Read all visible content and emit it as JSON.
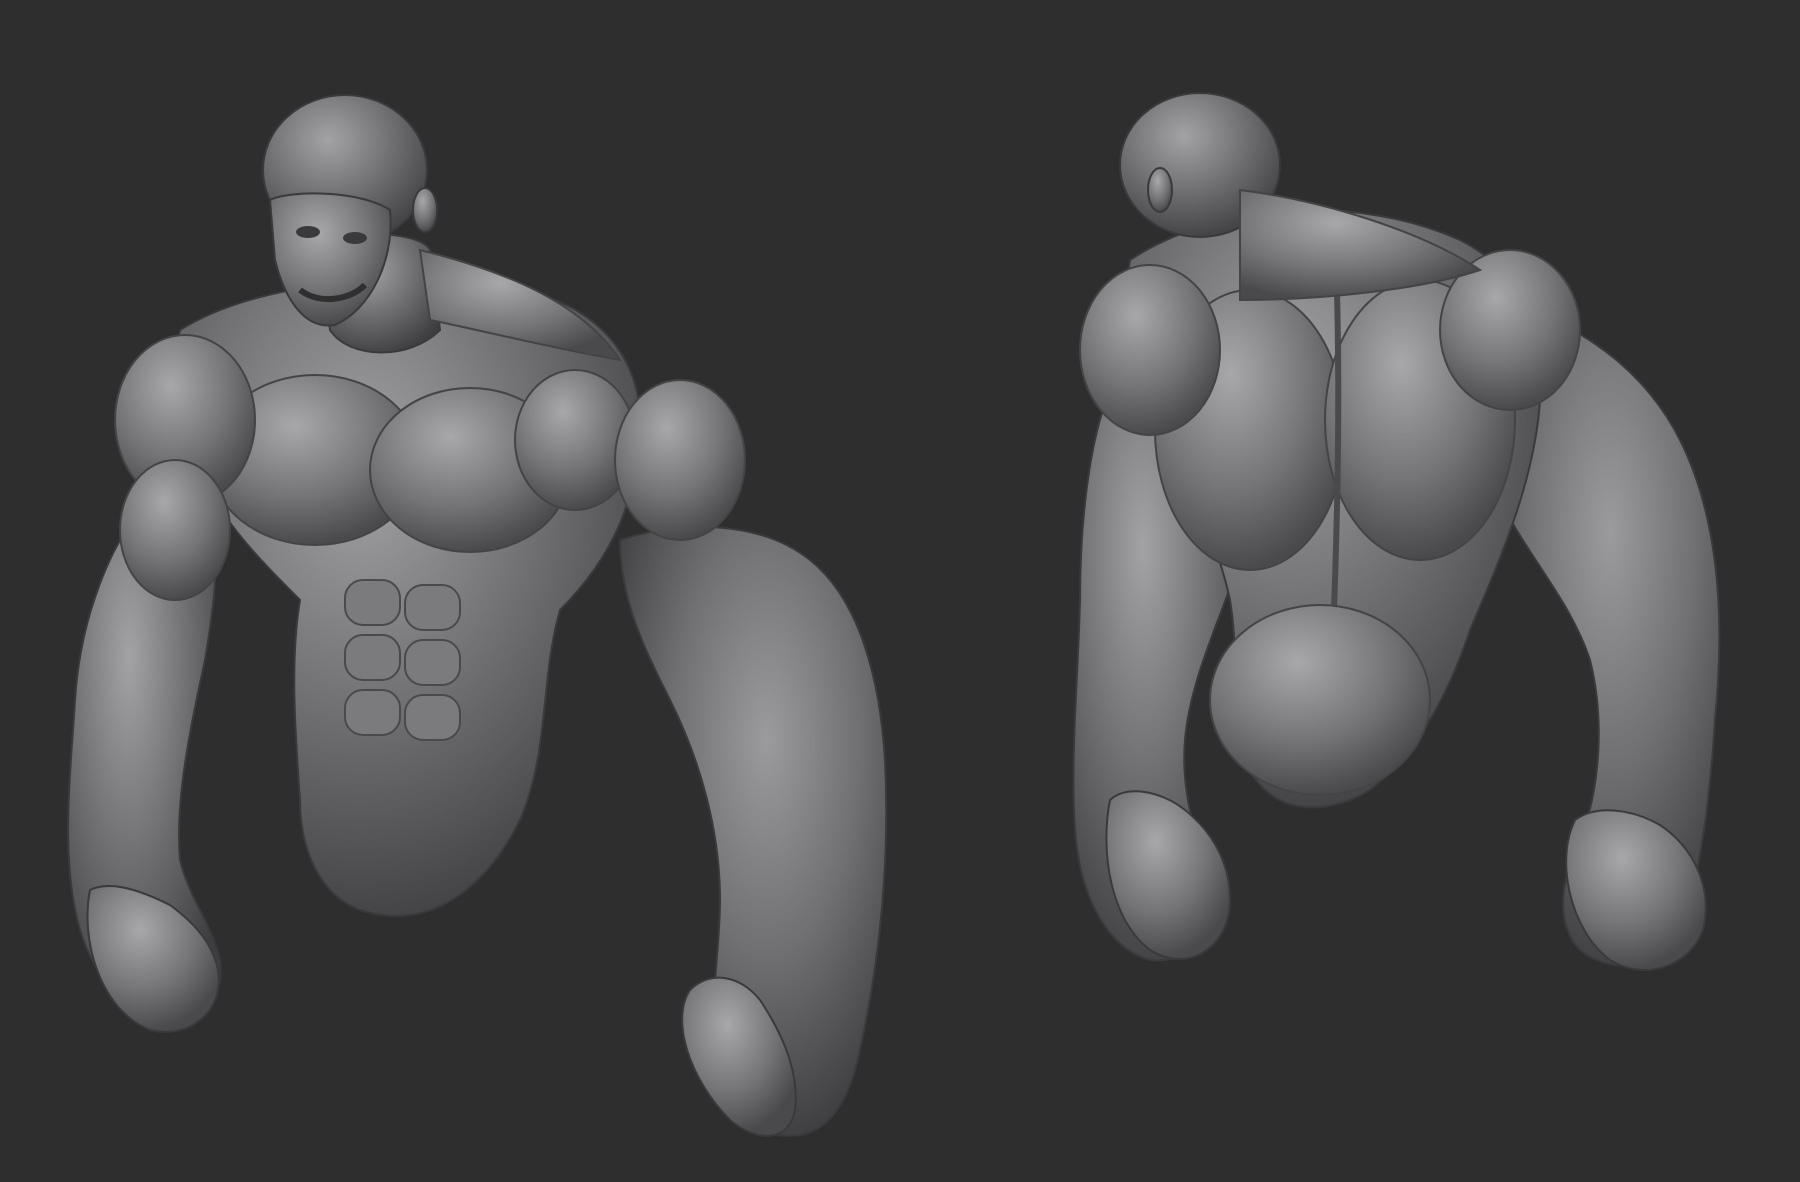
{
  "scene": {
    "background_color": "#2e2e2f",
    "clay_color": "#6f6f72",
    "clay_highlight": "#9a9a9d",
    "clay_shadow": "#3c3c3e"
  },
  "figures": [
    {
      "view": "front",
      "icon": "sculpt-front-view-icon"
    },
    {
      "view": "back",
      "icon": "sculpt-back-view-icon"
    }
  ]
}
